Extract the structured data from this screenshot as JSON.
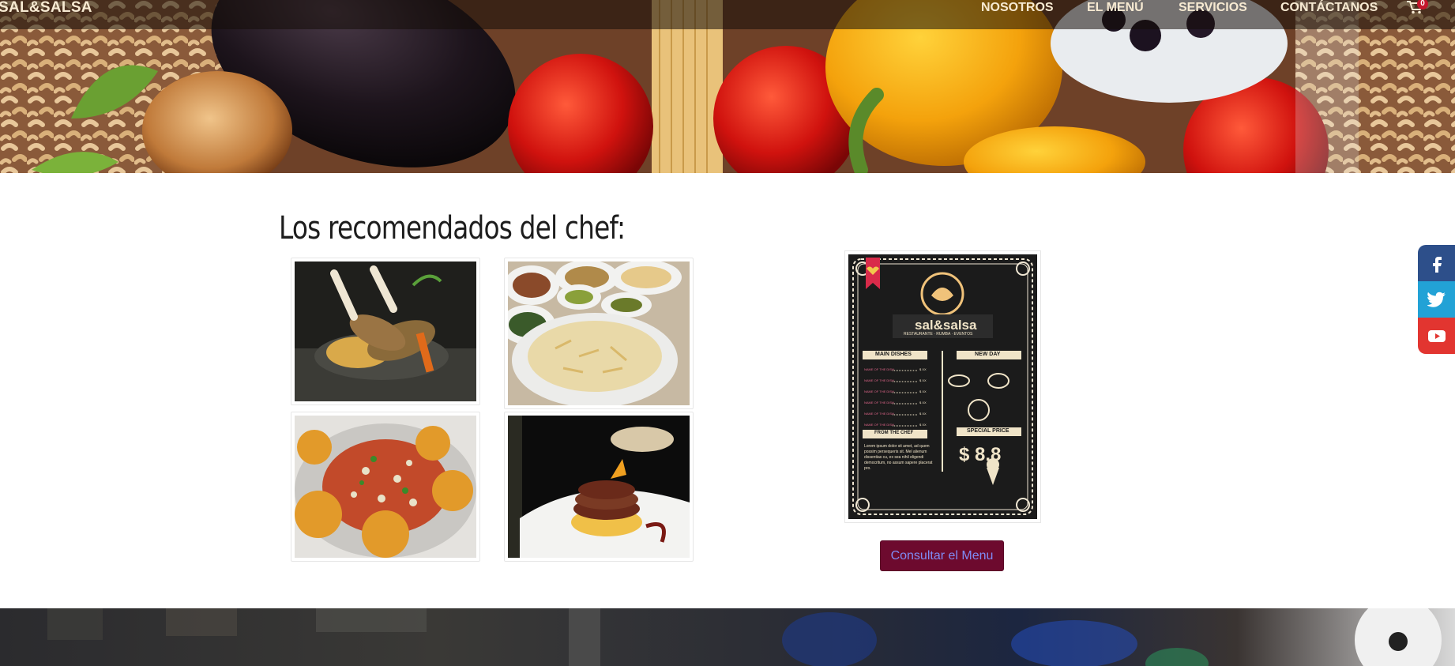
{
  "nav": {
    "brand": "SAL&SALSA",
    "links": [
      "NOSOTROS",
      "EL MENÚ",
      "SERVICIOS",
      "CONTÁCTANOS"
    ],
    "cart_count": "0"
  },
  "recommended": {
    "title": "Los recomendados del chef:",
    "dishes": [
      "grilled-lamb-shanks-photo",
      "baked-pasta-spread-photo",
      "croquettes-salad-photo",
      "grilled-octopus-photo"
    ]
  },
  "menu_card": {
    "logo": "sal&salsa",
    "tagline": "RESTAURANTE · RUMBA · EVENTOS",
    "main_dishes": "MAIN DISHES",
    "new_day": "NEW DAY",
    "from_the_chef": "FROM THE CHEF",
    "special_price": "SPECIAL PRICE",
    "price": "$ 8.8",
    "lorem": "Lorem ipsum dolor sit amet, ad quem possim persequeris sit. Mel alienum dissentias cu, ex sea nihil eligendi democritum, no assum sapere placerat pro.",
    "rows": [
      "NAME OF THE DISH",
      "NAME OF THE DISH",
      "NAME OF THE DISH",
      "NAME OF THE DISH",
      "NAME OF THE DISH",
      "NAME OF THE DISH"
    ],
    "row_price": "$ XX"
  },
  "actions": {
    "menu_button": "Consultar el Menu"
  },
  "social": [
    "facebook-icon",
    "twitter-icon",
    "youtube-icon"
  ],
  "colors": {
    "menu_button_bg": "#6d0a2e",
    "menu_button_text": "#7f8cf5",
    "facebook": "#2d4f8a",
    "twitter": "#22a2d6",
    "youtube": "#e23530"
  }
}
